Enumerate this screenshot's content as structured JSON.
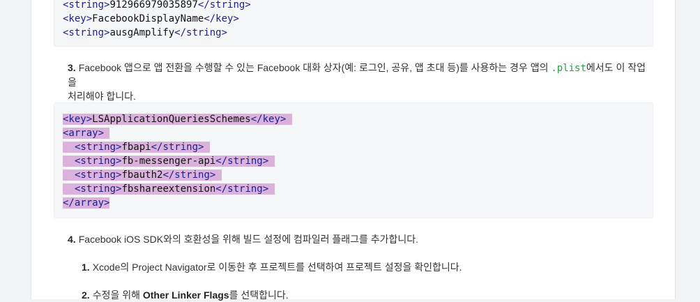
{
  "code_top": {
    "lines": [
      {
        "open": "<string>",
        "text": "912966979035897",
        "close": "</string>"
      },
      {
        "open": "<key>",
        "text": "FacebookDisplayName",
        "close": "</key>"
      },
      {
        "open": "<string>",
        "text": "ausgAmplify",
        "close": "</string>"
      }
    ]
  },
  "step3": {
    "number": "3.",
    "text_before": "Facebook 앱으로 앱 전환을 수행할 수 있는 Facebook 대화 상자(예: 로그인, 공유, 앱 초대 등)를 사용하는 경우 앱의 ",
    "code_inline": ".plist",
    "text_after": "에서도 이 작업을",
    "line2": "처리해야 합니다."
  },
  "code_main": {
    "l1_open": "<key>",
    "l1_text": "LSApplicationQueriesSchemes",
    "l1_close": "</key>",
    "l2": "<array>",
    "items": [
      {
        "open": "<string>",
        "text": "fbapi",
        "close": "</string>"
      },
      {
        "open": "<string>",
        "text": "fb-messenger-api",
        "close": "</string>"
      },
      {
        "open": "<string>",
        "text": "fbauth2",
        "close": "</string>"
      },
      {
        "open": "<string>",
        "text": "fbshareextension",
        "close": "</string>"
      }
    ],
    "l7": "</array>"
  },
  "step4": {
    "number": "4.",
    "text": "Facebook iOS SDK와의 호환성을 위해 빌드 설정에 컴파일러 플래그를 추가합니다."
  },
  "sub1": {
    "number": "1.",
    "text": "Xcode의 Project Navigator로 이동한 후 프로젝트를 선택하여 프로젝트 설정을 확인합니다."
  },
  "sub2": {
    "number": "2.",
    "text_before": "수정을 위해 ",
    "bold": "Other Linker Flags",
    "text_after": "를 선택합니다."
  }
}
